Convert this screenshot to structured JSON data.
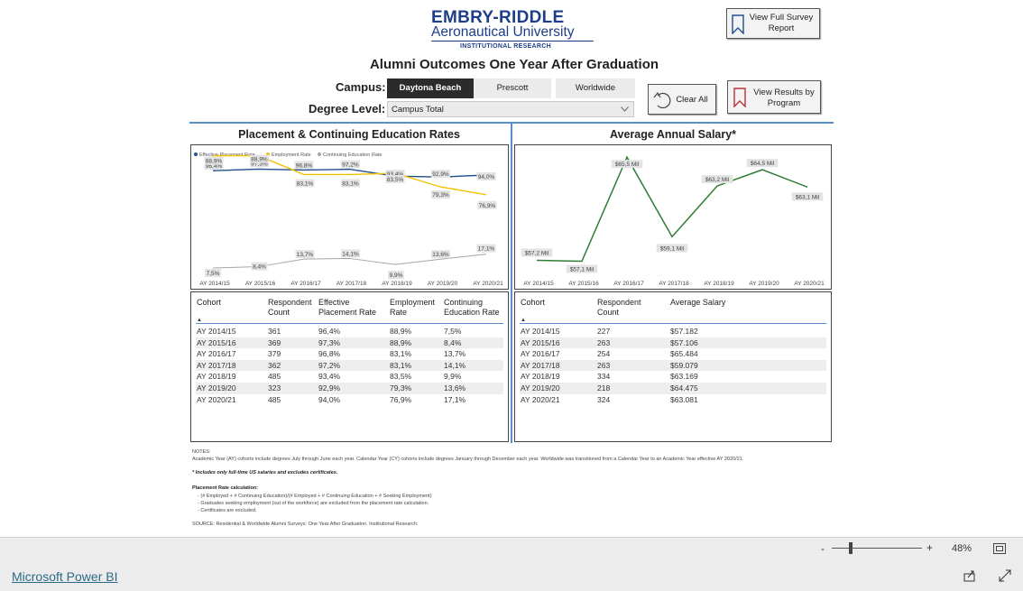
{
  "header": {
    "logo_line1": "EMBRY-RIDDLE",
    "logo_line2": "Aeronautical University",
    "logo_line3": "INSTITUTIONAL RESEARCH",
    "title": "Alumni Outcomes One Year After Graduation"
  },
  "buttons": {
    "full_survey": "View Full Survey Report",
    "clear_all": "Clear All",
    "by_program": "View Results by Program"
  },
  "filters": {
    "campus_label": "Campus:",
    "campus_options": [
      "Daytona Beach",
      "Prescott",
      "Worldwide"
    ],
    "campus_selected": "Daytona Beach",
    "degree_label": "Degree Level:",
    "degree_value": "Campus Total"
  },
  "left_panel": {
    "title": "Placement & Continuing Education Rates",
    "legend": [
      "Effective Placement Rate",
      "Employment Rate",
      "Continuing Education Rate"
    ],
    "table": {
      "headers": [
        "Cohort",
        "Respondent Count",
        "Effective Placement Rate",
        "Employment Rate",
        "Continuing Education Rate"
      ],
      "rows": [
        [
          "AY 2014/15",
          "361",
          "96,4%",
          "88,9%",
          "7,5%"
        ],
        [
          "AY 2015/16",
          "369",
          "97,3%",
          "88,9%",
          "8,4%"
        ],
        [
          "AY 2016/17",
          "379",
          "96,8%",
          "83,1%",
          "13,7%"
        ],
        [
          "AY 2017/18",
          "362",
          "97,2%",
          "83,1%",
          "14,1%"
        ],
        [
          "AY 2018/19",
          "485",
          "93,4%",
          "83,5%",
          "9,9%"
        ],
        [
          "AY 2019/20",
          "323",
          "92,9%",
          "79,3%",
          "13,6%"
        ],
        [
          "AY 2020/21",
          "485",
          "94,0%",
          "76,9%",
          "17,1%"
        ]
      ]
    }
  },
  "right_panel": {
    "title": "Average Annual Salary*",
    "table": {
      "headers": [
        "Cohort",
        "Respondent Count",
        "Average Salary"
      ],
      "rows": [
        [
          "AY 2014/15",
          "227",
          "$57.182"
        ],
        [
          "AY 2015/16",
          "263",
          "$57.106"
        ],
        [
          "AY 2016/17",
          "254",
          "$65.484"
        ],
        [
          "AY 2017/18",
          "263",
          "$59.079"
        ],
        [
          "AY 2018/19",
          "334",
          "$63.169"
        ],
        [
          "AY 2019/20",
          "218",
          "$64.475"
        ],
        [
          "AY 2020/21",
          "324",
          "$63.081"
        ]
      ]
    }
  },
  "chart_data": [
    {
      "type": "line",
      "title": "Placement & Continuing Education Rates",
      "categories": [
        "AY 2014/15",
        "AY 2015/16",
        "AY 2016/17",
        "AY 2017/18",
        "AY 2018/19",
        "AY 2019/20",
        "AY 2020/21"
      ],
      "series": [
        {
          "name": "Effective Placement Rate",
          "color": "#1f4e8c",
          "values": [
            96.4,
            97.3,
            96.8,
            97.2,
            93.4,
            92.9,
            94.0
          ],
          "labels": [
            "96,4%",
            "97,3%",
            "96,8%",
            "97,2%",
            "93,4%",
            "92,9%",
            "94,0%"
          ]
        },
        {
          "name": "Employment Rate",
          "color": "#f2c200",
          "values": [
            88.9,
            88.9,
            83.1,
            83.1,
            83.5,
            79.3,
            76.9
          ],
          "labels": [
            "88,9%",
            "88,9%",
            "83,1%",
            "83,1%",
            "83,5%",
            "79,3%",
            "76,9%"
          ]
        },
        {
          "name": "Continuing Education Rate",
          "color": "#a6a6a6",
          "values": [
            7.5,
            8.4,
            13.7,
            14.1,
            9.9,
            13.6,
            17.1
          ],
          "labels": [
            "7,5%",
            "8,4%",
            "13,7%",
            "14,1%",
            "9,9%",
            "13,6%",
            "17,1%"
          ]
        }
      ],
      "legend": "top-left"
    },
    {
      "type": "line",
      "title": "Average Annual Salary*",
      "categories": [
        "AY 2014/15",
        "AY 2015/16",
        "AY 2016/17",
        "AY 2017/18",
        "AY 2018/19",
        "AY 2019/20",
        "AY 2020/21"
      ],
      "series": [
        {
          "color": "#2e7d32",
          "values": [
            57182,
            57106,
            65484,
            59079,
            63169,
            64475,
            63081
          ],
          "labels": [
            "$57,2 Mil",
            "$57,1 Mil",
            "$65,5 Mil",
            "$59,1 Mil",
            "$63,2 Mil",
            "$64,5 Mil",
            "$63,1 Mil"
          ]
        }
      ]
    }
  ],
  "notes": {
    "notes_label": "NOTES:",
    "line1": "Academic Year (AY) cohorts include degrees July through June each year. Calendar Year (CY) cohorts include degrees January through December each year. Worldwide was transitioned from a Calendar Year to an Academic Year effective AY 2020/21.",
    "salary_note": "* Includes only full-time US salaries and excludes certificates.",
    "placement_label": "Placement Rate calculation:",
    "placement_1": "- (# Employed + # Continuing Education)/(# Employed + # Continuing Education + # Seeking Employment)",
    "placement_2": "- Graduates seeking employment (out of the workforce) are excluded from the placement rate calculation.",
    "placement_3": "- Certificates are excluded.",
    "source": "SOURCE: Residential & Worldwide Alumni Surveys: One Year After Graduation. Institutional Research."
  },
  "zoom": {
    "value": "48%",
    "minus": "-",
    "plus": "+"
  },
  "footer": {
    "brand": "Microsoft Power BI"
  }
}
